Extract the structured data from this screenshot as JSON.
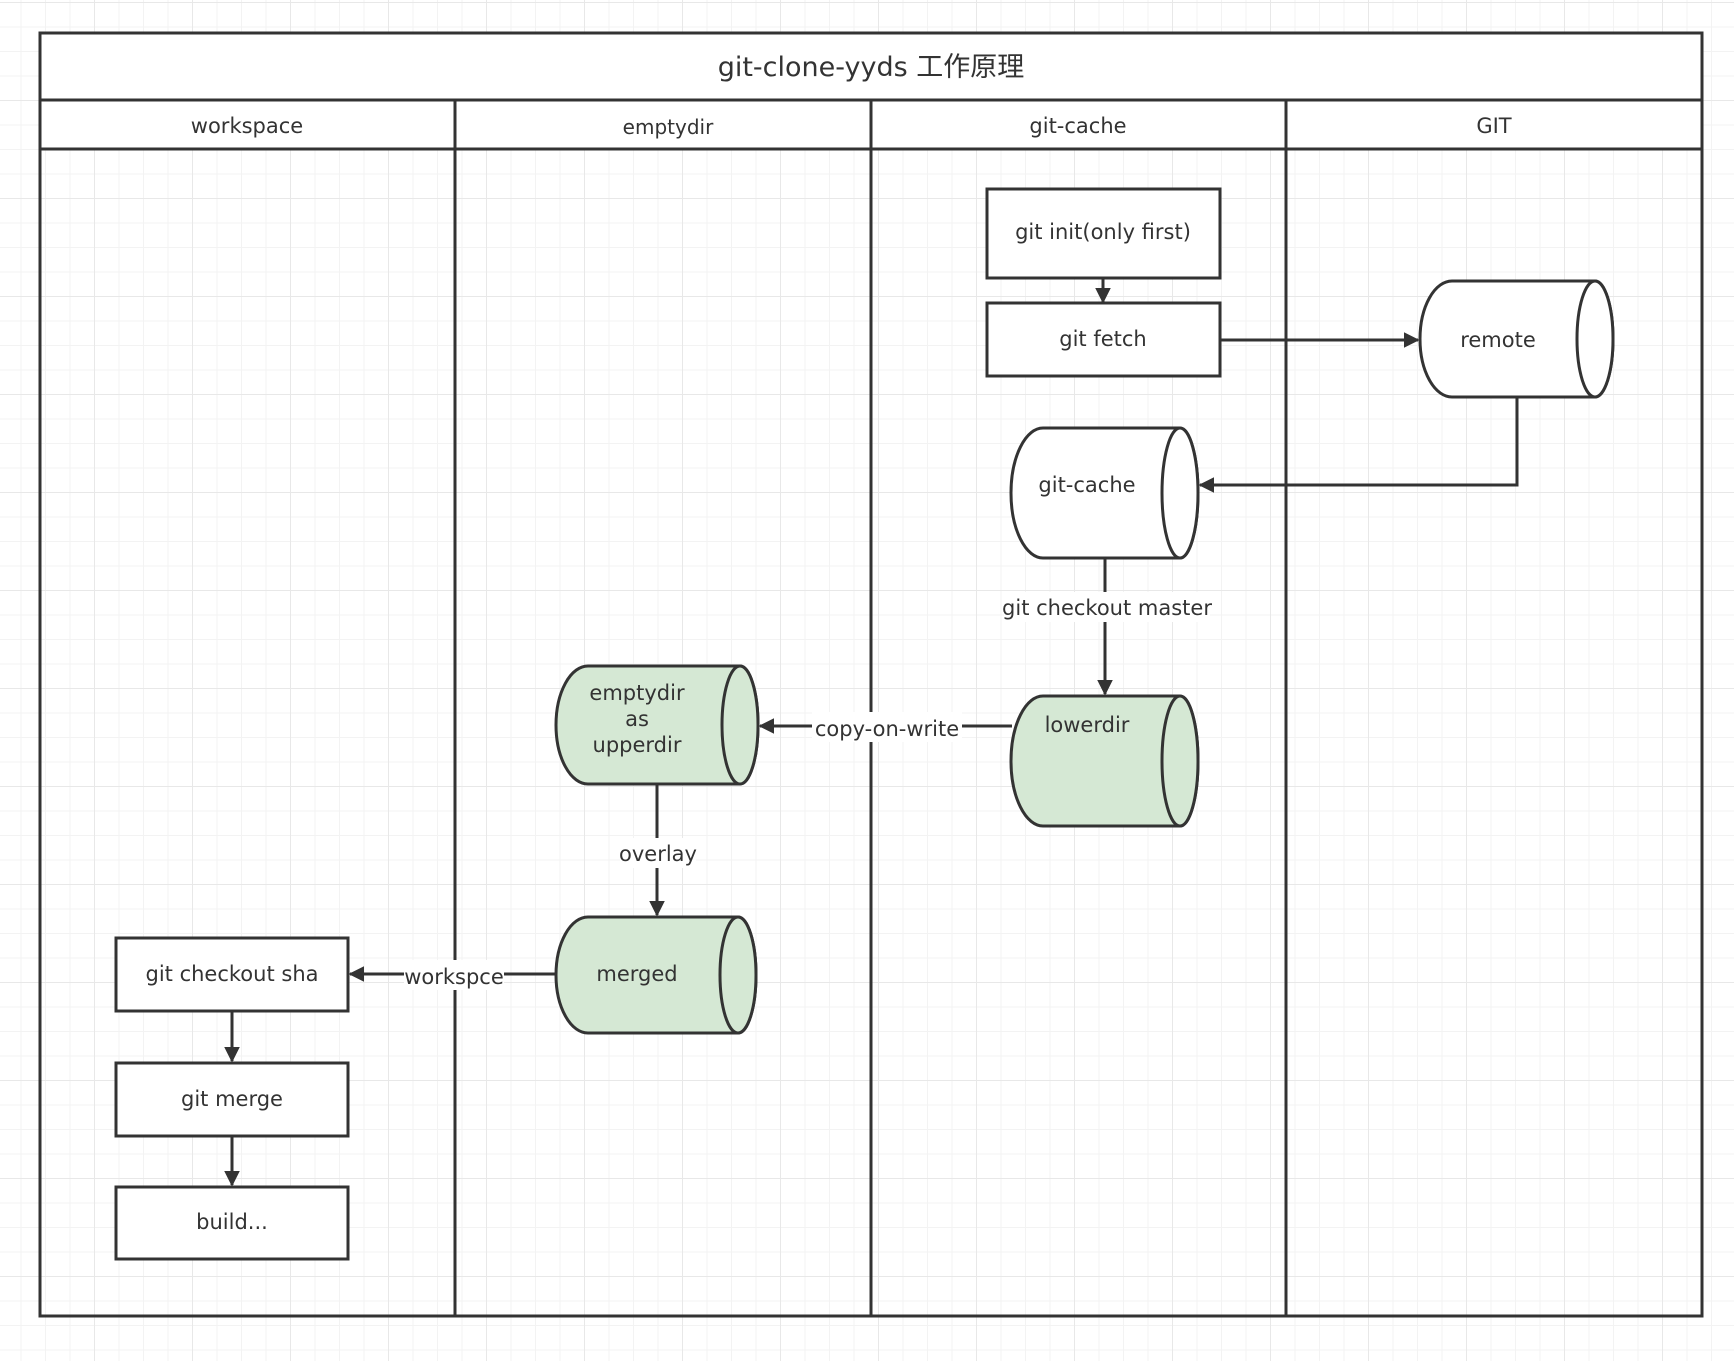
{
  "title": "git-clone-yyds 工作原理",
  "lanes": [
    {
      "id": "workspace",
      "label": "workspace"
    },
    {
      "id": "emptydir",
      "label": "emptydir"
    },
    {
      "id": "git-cache",
      "label": "git-cache"
    },
    {
      "id": "git",
      "label": "GIT"
    }
  ],
  "nodes": {
    "git_init": {
      "label": "git init(only first)",
      "shape": "process",
      "lane": "git-cache"
    },
    "git_fetch": {
      "label": "git fetch",
      "shape": "process",
      "lane": "git-cache"
    },
    "remote": {
      "label": "remote",
      "shape": "cylinder",
      "lane": "git"
    },
    "git_cache_store": {
      "label": "git-cache",
      "shape": "cylinder",
      "lane": "git-cache"
    },
    "lowerdir": {
      "label": "lowerdir",
      "shape": "cylinder",
      "lane": "git-cache",
      "fill": "#d5e8d4"
    },
    "upperdir": {
      "lines": [
        "emptydir",
        "as",
        "upperdir"
      ],
      "shape": "cylinder",
      "lane": "emptydir",
      "fill": "#d5e8d4"
    },
    "merged": {
      "label": "merged",
      "shape": "cylinder",
      "lane": "emptydir",
      "fill": "#d5e8d4"
    },
    "checkout_sha": {
      "label": "git checkout sha",
      "shape": "process",
      "lane": "workspace"
    },
    "git_merge": {
      "label": "git merge",
      "shape": "process",
      "lane": "workspace"
    },
    "build": {
      "label": "build...",
      "shape": "process",
      "lane": "workspace"
    }
  },
  "edges": {
    "init_to_fetch": {
      "from": "git_init",
      "to": "git_fetch",
      "label": ""
    },
    "fetch_to_remote": {
      "from": "git_fetch",
      "to": "remote",
      "label": ""
    },
    "remote_to_cache": {
      "from": "remote",
      "to": "git_cache_store",
      "label": ""
    },
    "cache_to_lower": {
      "from": "git_cache_store",
      "to": "lowerdir",
      "label": "git checkout master"
    },
    "lower_to_upper": {
      "from": "lowerdir",
      "to": "upperdir",
      "label": "copy-on-write"
    },
    "upper_to_merged": {
      "from": "upperdir",
      "to": "merged",
      "label": "overlay"
    },
    "merged_to_checkout": {
      "from": "merged",
      "to": "checkout_sha",
      "label": "workspce"
    },
    "checkout_to_merge": {
      "from": "checkout_sha",
      "to": "git_merge",
      "label": ""
    },
    "merge_to_build": {
      "from": "git_merge",
      "to": "build",
      "label": ""
    }
  },
  "colors": {
    "stroke": "#333333",
    "storage_fill": "#d5e8d4",
    "default_fill": "#ffffff"
  }
}
